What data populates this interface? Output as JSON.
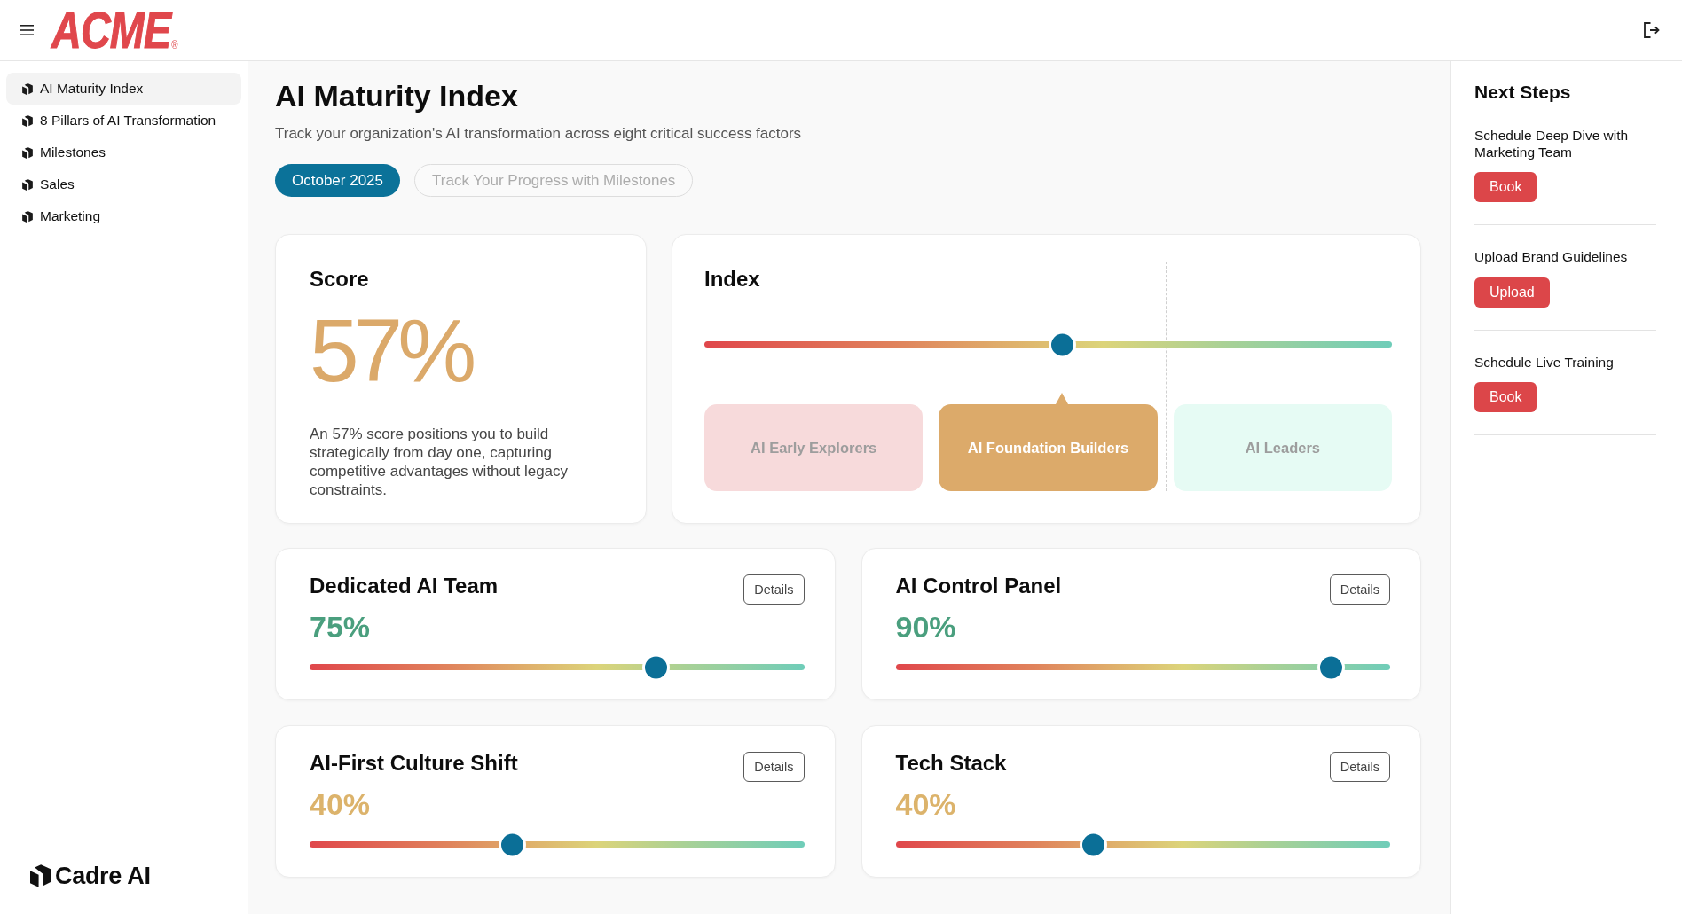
{
  "header": {
    "logo": {
      "text": "ACME",
      "mark": "®"
    }
  },
  "sidebar": {
    "items": [
      {
        "label": "AI Maturity Index",
        "selected": true
      },
      {
        "label": "8 Pillars of AI Transformation",
        "selected": false
      },
      {
        "label": "Milestones",
        "selected": false
      },
      {
        "label": "Sales",
        "selected": false
      },
      {
        "label": "Marketing",
        "selected": false
      }
    ],
    "brand": "Cadre AI"
  },
  "page": {
    "title": "AI Maturity Index",
    "subtitle": "Track your organization's AI transformation across eight critical success factors",
    "period_button": {
      "label": "October 2025"
    },
    "milestones_button": {
      "label": "Track Your Progress with Milestones",
      "disabled": true
    }
  },
  "score": {
    "title": "Score",
    "value": "57%",
    "description": "An 57% score positions you to build strategically from day one, capturing competitive advantages without legacy constraints."
  },
  "index": {
    "title": "Index",
    "level": 0.52,
    "tiers": [
      {
        "label": "AI Early Explorers",
        "selected": false,
        "color": "#f7dadb"
      },
      {
        "label": "AI Foundation Builders",
        "selected": true,
        "color": "#dcaa6a"
      },
      {
        "label": "AI Leaders",
        "selected": false,
        "color": "#e6fbf4"
      }
    ]
  },
  "metrics": [
    {
      "title": "Dedicated AI Team",
      "value": "75%",
      "level": 0.7,
      "color": "#4a9f7e",
      "button": "Details"
    },
    {
      "title": "AI Control Panel",
      "value": "90%",
      "level": 0.88,
      "color": "#4a9f7e",
      "button": "Details"
    },
    {
      "title": "AI-First Culture Shift",
      "value": "40%",
      "level": 0.41,
      "color": "#dcb36b",
      "button": "Details"
    },
    {
      "title": "Tech Stack",
      "value": "40%",
      "level": 0.4,
      "color": "#dcb36b",
      "button": "Details"
    }
  ],
  "next_steps": {
    "title": "Next Steps",
    "items": [
      {
        "label": "Schedule Deep Dive with Marketing Team",
        "button": "Book"
      },
      {
        "label": "Upload Brand Guidelines",
        "button": "Upload"
      },
      {
        "label": "Schedule Live Training",
        "button": "Book"
      }
    ]
  }
}
